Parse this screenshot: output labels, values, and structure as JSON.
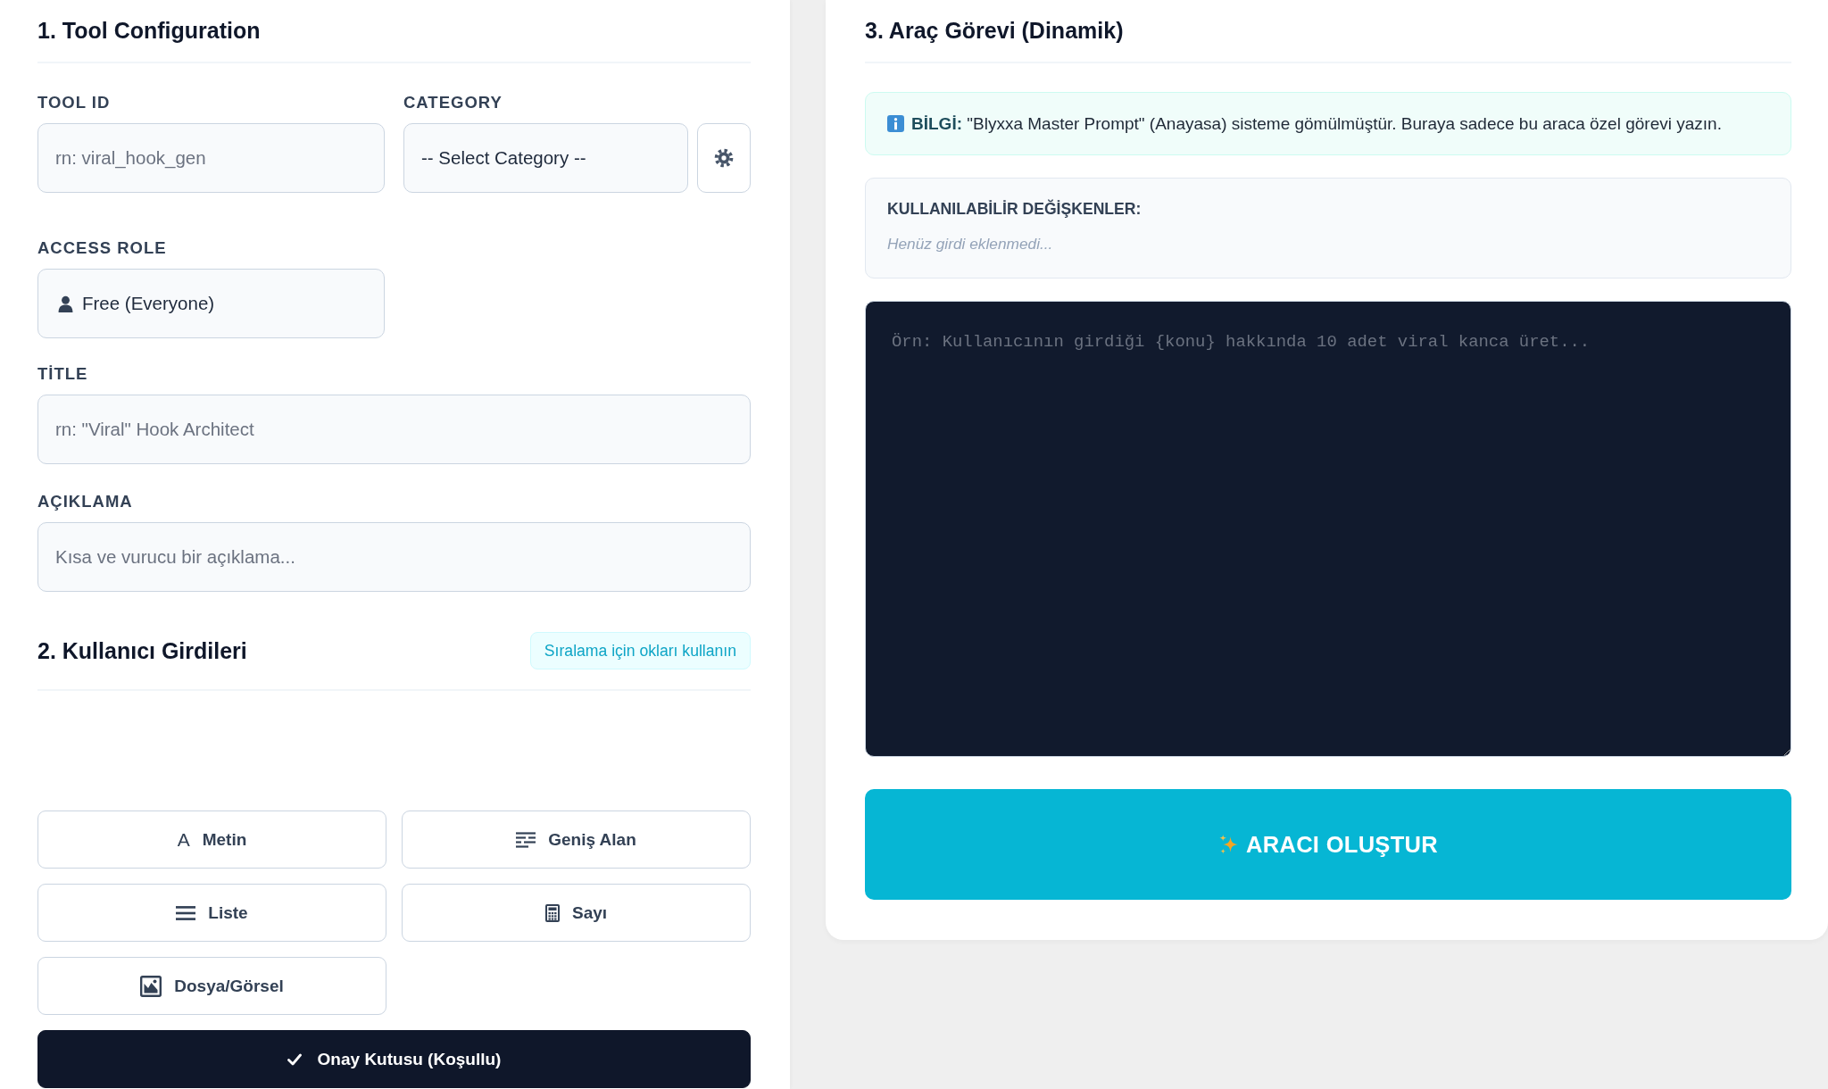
{
  "tool_configuration": {
    "title": "1. Tool Configuration",
    "tool_id": {
      "label": "TOOL ID",
      "placeholder": "rn: viral_hook_gen"
    },
    "category": {
      "label": "CATEGORY",
      "value": "-- Select Category --"
    },
    "access_role": {
      "label": "ACCESS ROLE",
      "value": "Free (Everyone)"
    },
    "title_field": {
      "label": "TİTLE",
      "placeholder": "rn: \"Viral\" Hook Architect"
    },
    "description": {
      "label": "AÇIKLAMA",
      "placeholder": "Kısa ve vurucu bir açıklama..."
    }
  },
  "user_inputs": {
    "title": "2. Kullanıcı Girdileri",
    "hint": "Sıralama için okları kullanın",
    "input_types": [
      {
        "label": "Metin",
        "kind": "text",
        "glyph": "A"
      },
      {
        "label": "Geniş Alan",
        "kind": "textarea"
      },
      {
        "label": "Liste",
        "kind": "list"
      },
      {
        "label": "Sayı",
        "kind": "number"
      },
      {
        "label": "Dosya/Görsel",
        "kind": "file"
      },
      {
        "label": "Onay Kutusu (Koşullu)",
        "kind": "checkbox"
      }
    ]
  },
  "tool_task": {
    "title": "3. Araç Görevi (Dinamik)",
    "info": "**BİLGİ:** \"Blyxxa Master Prompt\" (Anayasa) sisteme gömülmüştür. Buraya sadece bu araca özel görevi yazın.",
    "variables": {
      "label": "KULLANILABİLİR DEĞİŞKENLER:",
      "empty_text": "Henüz girdi eklenmedi..."
    },
    "prompt": {
      "placeholder": "Örn: Kullanıcının girdiği {konu} hakkında 10 adet viral kanca üret..."
    },
    "submit": "ARACI OLUŞTUR"
  }
}
